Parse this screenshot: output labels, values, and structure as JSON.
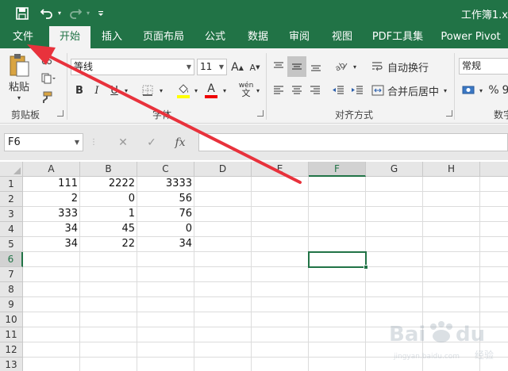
{
  "quick_access": {
    "save_icon": "save-icon",
    "undo_icon": "undo-icon",
    "redo_icon": "redo-icon",
    "customize_icon": "customize-qat-icon"
  },
  "window": {
    "title": "工作簿1.x"
  },
  "tabs": [
    {
      "label": "文件"
    },
    {
      "label": "开始"
    },
    {
      "label": "插入"
    },
    {
      "label": "页面布局"
    },
    {
      "label": "公式"
    },
    {
      "label": "数据"
    },
    {
      "label": "审阅"
    },
    {
      "label": "视图"
    },
    {
      "label": "PDF工具集"
    },
    {
      "label": "Power Pivot"
    }
  ],
  "active_tab": "开始",
  "ribbon": {
    "clipboard": {
      "paste_label": "粘贴",
      "group_label": "剪贴板"
    },
    "font": {
      "font_name": "等线",
      "font_size": "11",
      "grow_label": "A",
      "shrink_label": "A",
      "bold": "B",
      "italic": "I",
      "underline": "U",
      "font_color_label": "A",
      "phonetic_label": "wén",
      "group_label": "字体"
    },
    "alignment": {
      "wrap_text": "自动换行",
      "merge_center": "合并后居中",
      "group_label": "对齐方式"
    },
    "number": {
      "format": "常规",
      "percent": "%",
      "comma": "9",
      "group_label": "数字"
    }
  },
  "formula_bar": {
    "name_box": "F6",
    "cancel_icon": "cancel-icon",
    "enter_icon": "enter-icon",
    "fx_label": "fx",
    "formula": ""
  },
  "grid": {
    "columns": [
      "A",
      "B",
      "C",
      "D",
      "E",
      "F",
      "G",
      "H"
    ],
    "rows": [
      "1",
      "2",
      "3",
      "4",
      "5",
      "6",
      "7",
      "8",
      "9",
      "10",
      "11",
      "12",
      "13"
    ],
    "selected_cell": "F6",
    "cells": [
      [
        "111",
        "2222",
        "3333"
      ],
      [
        "2",
        "0",
        "56"
      ],
      [
        "333",
        "1",
        "76"
      ],
      [
        "34",
        "45",
        "0"
      ],
      [
        "34",
        "22",
        "34"
      ]
    ]
  },
  "annotation": {
    "arrow_color": "#e8323c"
  },
  "watermark": {
    "text": "Bai du 经验",
    "sub": "jingyan.baidu.com"
  },
  "colors": {
    "accent": "#217346"
  }
}
